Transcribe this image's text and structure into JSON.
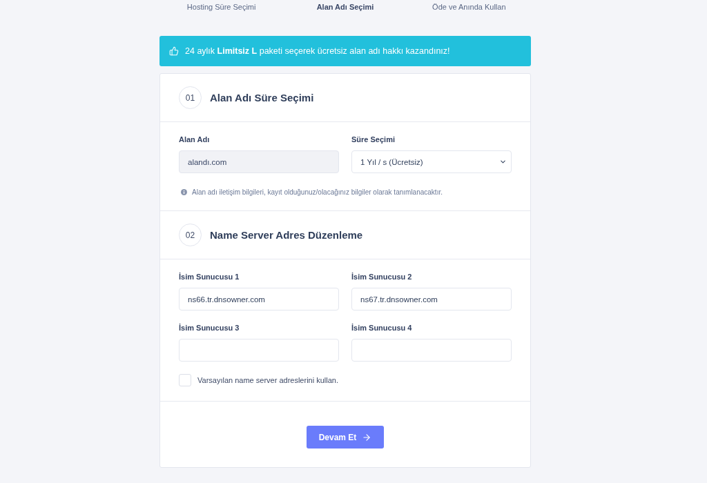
{
  "steps": [
    {
      "label": "Hosting Süre Seçimi",
      "selected": false
    },
    {
      "label": "Alan Adı Seçimi",
      "selected": true
    },
    {
      "label": "Öde ve Anında Kullan",
      "selected": false
    }
  ],
  "banner": {
    "text": "24 aylık **Limitsiz L** paketi seçerek ücretsiz alan adı hakkı kazandınız!"
  },
  "sections": [
    {
      "number": "01",
      "title": "Alan Adı Süre Seçimi",
      "fields": [
        {
          "kind": "input",
          "label": "Alan Adı",
          "value": "alandı.com",
          "disabled": true
        },
        {
          "kind": "select",
          "label": "Süre Seçimi",
          "value": "1 Yıl / s (Ücretsiz)",
          "disabled": false
        }
      ],
      "note": "Alan adı iletişim bilgileri, kayıt olduğunuz/olacağınız bilgiler olarak tanımlanacaktır."
    },
    {
      "number": "02",
      "title": "Name Server Adres Düzenleme",
      "fields": [
        {
          "kind": "input",
          "label": "İsim Sunucusu 1",
          "value": "ns66.tr.dnsowner.com",
          "disabled": false
        },
        {
          "kind": "input",
          "label": "İsim Sunucusu 2",
          "value": "ns67.tr.dnsowner.com",
          "disabled": false
        },
        {
          "kind": "input",
          "label": "İsim Sunucusu 3",
          "disabled": false
        },
        {
          "kind": "input",
          "label": "İsim Sunucusu 4",
          "disabled": false
        }
      ],
      "checkbox": {
        "label": "Varsayılan name server adreslerini kullan.",
        "checked": false
      }
    }
  ],
  "submit_button": {
    "label": "Devam Et"
  }
}
